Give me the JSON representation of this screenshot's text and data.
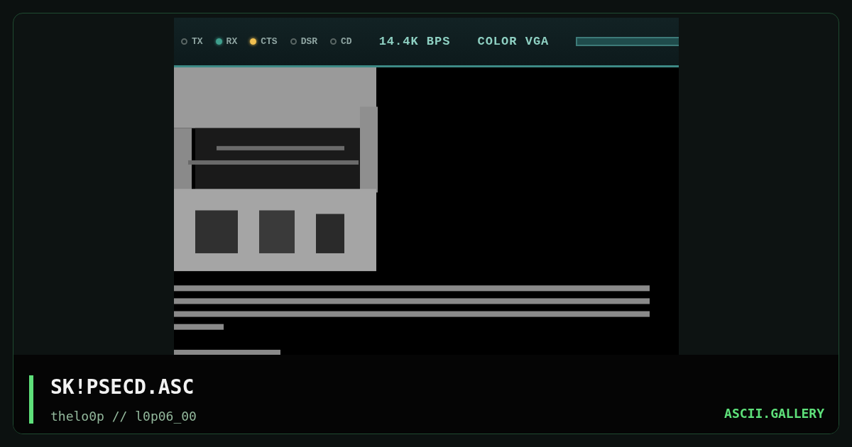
{
  "status_bar": {
    "indicators": [
      {
        "label": "TX",
        "on": false,
        "color": "#5a6664"
      },
      {
        "label": "RX",
        "on": true,
        "color": "#3fa08e"
      },
      {
        "label": "CTS",
        "on": true,
        "color": "#f0c050"
      },
      {
        "label": "DSR",
        "on": false,
        "color": "#5a6664"
      },
      {
        "label": "CD",
        "on": false,
        "color": "#5a6664"
      }
    ],
    "speed": "14.4K BPS",
    "mode": "COLOR VGA"
  },
  "caption": {
    "title": "SK!PSECD.ASC",
    "byline": "thelo0p // l0p06_00",
    "site": "ASCII.GALLERY"
  }
}
